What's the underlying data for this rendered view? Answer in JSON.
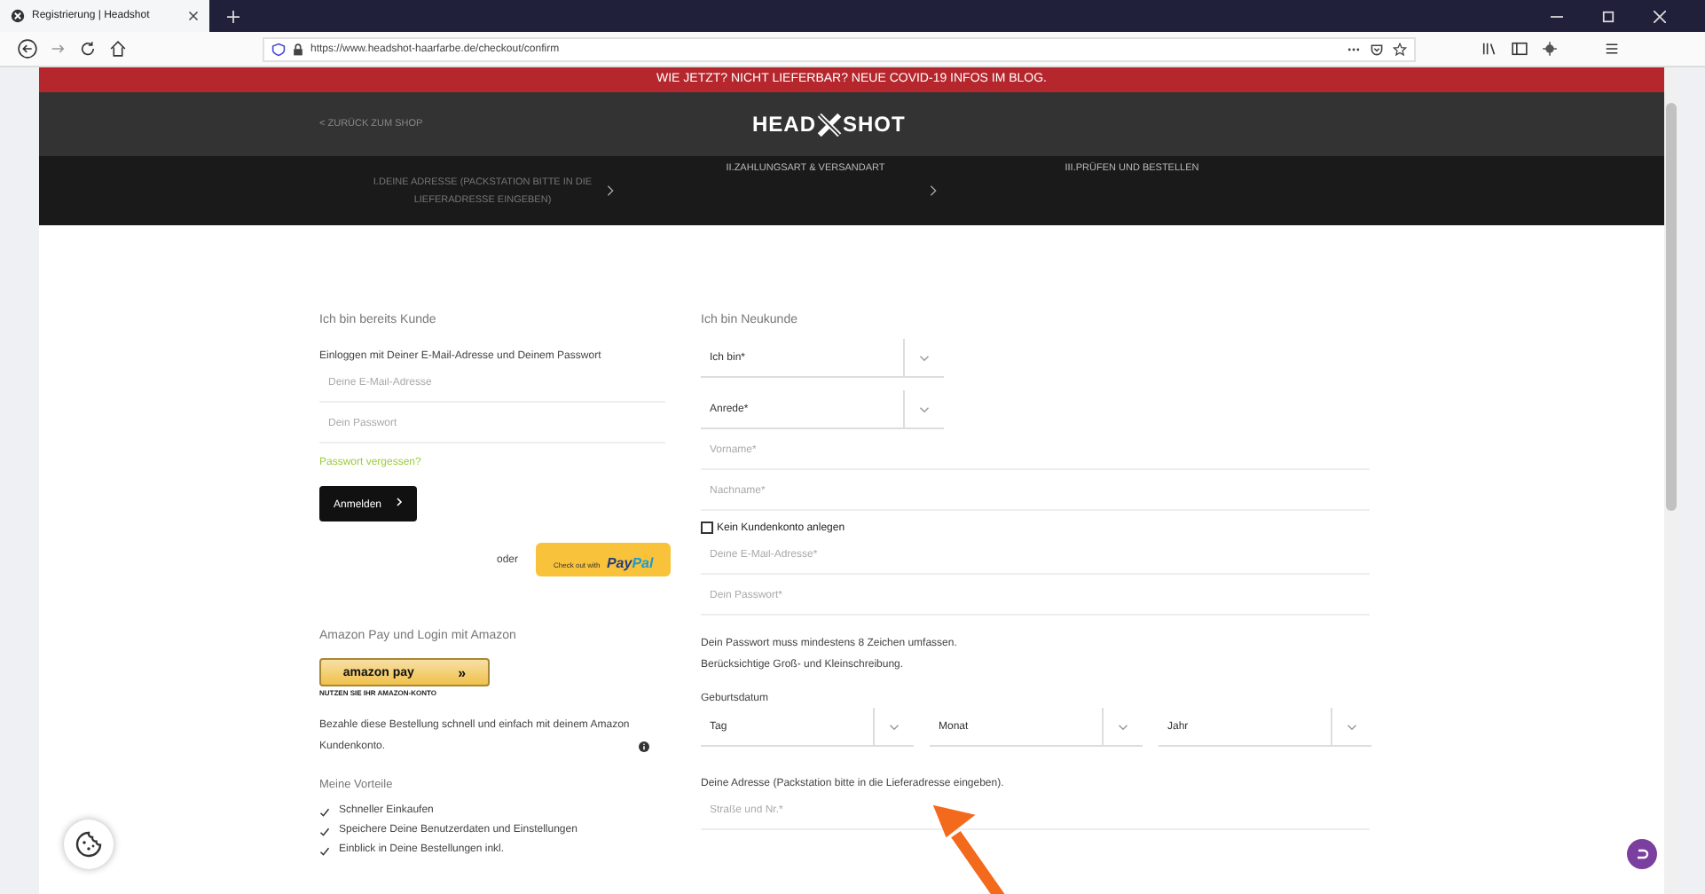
{
  "browser": {
    "tab_title": "Registrierung | Headshot",
    "url": "https://www.headshot-haarfarbe.de/checkout/confirm"
  },
  "banner": "WIE JETZT? NICHT LIEFERBAR? NEUE COVID-19 INFOS IM BLOG.",
  "header": {
    "back_link": "< ZURÜCK ZUM SHOP",
    "logo_left": "HEAD",
    "logo_right": "SHOT"
  },
  "steps": [
    {
      "number": "I.",
      "label": "DEINE ADRESSE (PACKSTATION BITTE IN DIE LIEFERADRESSE EINGEBEN)"
    },
    {
      "number": "II.",
      "label": "ZAHLUNGSART & VERSANDART"
    },
    {
      "number": "III.",
      "label": "PRÜFEN UND BESTELLEN"
    }
  ],
  "login": {
    "title": "Ich bin bereits Kunde",
    "intro": "Einloggen mit Deiner E-Mail-Adresse und Deinem Passwort",
    "email": {
      "placeholder": "Deine E-Mail-Adresse"
    },
    "password": {
      "placeholder": "Dein Passwort"
    },
    "forgot_link": "Passwort vergessen?",
    "submit": "Anmelden",
    "or": "oder",
    "paypal": {
      "prefix": "Check out with",
      "brand_a": "Pay",
      "brand_b": "Pal"
    }
  },
  "amazon": {
    "title": "Amazon Pay und Login mit Amazon",
    "button": "amazon pay",
    "button_arrows": "»",
    "caption": "NUTZEN SIE IHR AMAZON-KONTO",
    "text": "Bezahle diese Bestellung schnell und einfach mit deinem Amazon Kundenkonto."
  },
  "benefits": {
    "title": "Meine Vorteile",
    "items": [
      "Schneller Einkaufen",
      "Speichere Deine Benutzerdaten und Einstellungen",
      "Einblick in Deine Bestellungen inkl."
    ]
  },
  "register": {
    "title": "Ich bin Neukunde",
    "selects": [
      {
        "value": "Ich bin*"
      },
      {
        "value": "Anrede*"
      }
    ],
    "name_fields": [
      {
        "placeholder": "Vorname*"
      },
      {
        "placeholder": "Nachname*"
      }
    ],
    "no_account": {
      "label": "Kein Kundenkonto anlegen",
      "checked": false
    },
    "account_fields": [
      {
        "placeholder": "Deine E-Mail-Adresse*"
      },
      {
        "placeholder": "Dein Passwort*"
      }
    ],
    "password_hint": [
      "Dein Passwort muss mindestens 8 Zeichen umfassen.",
      "Berücksichtige Groß- und Kleinschreibung."
    ],
    "birthdate_label": "Geburtsdatum",
    "birthdate": [
      {
        "value": "Tag"
      },
      {
        "value": "Monat"
      },
      {
        "value": "Jahr"
      }
    ],
    "address_label": "Deine Adresse (Packstation bitte in die Lieferadresse eingeben).",
    "street": {
      "placeholder": "Straße und Nr.*"
    }
  }
}
